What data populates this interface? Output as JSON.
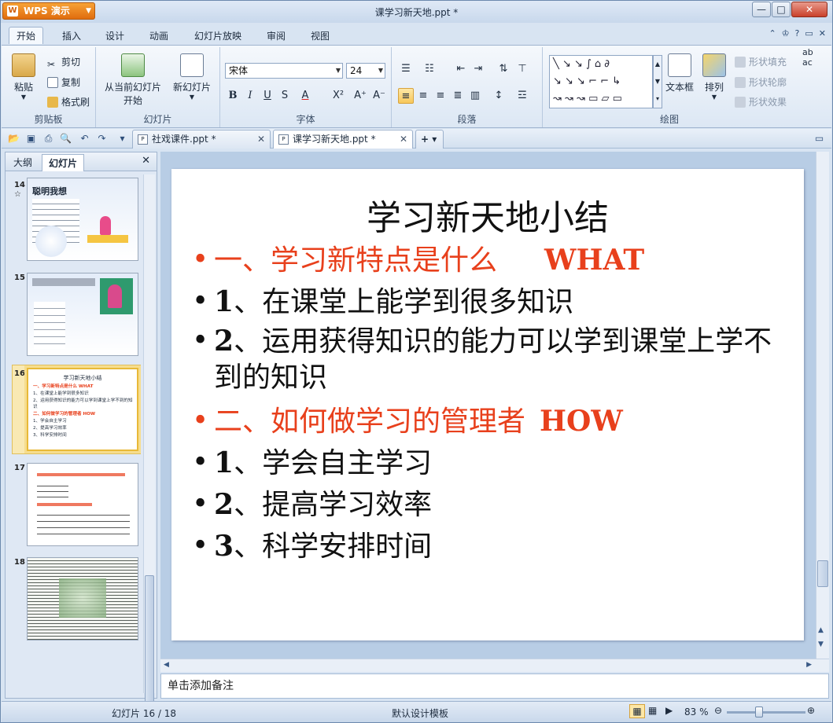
{
  "app": {
    "badge": "WPS 演示",
    "window_title": "课学习新天地.ppt *"
  },
  "ribbon_tabs": [
    "开始",
    "插入",
    "设计",
    "动画",
    "幻灯片放映",
    "审阅",
    "视图"
  ],
  "ribbon": {
    "clipboard": {
      "paste": "粘贴",
      "cut": "剪切",
      "copy": "复制",
      "format_painter": "格式刷",
      "group": "剪贴板"
    },
    "slides": {
      "from_current": "从当前幻灯片",
      "start": "开始",
      "new_slide": "新幻灯片",
      "group": "幻灯片"
    },
    "font": {
      "family": "宋体",
      "size": "24",
      "group": "字体"
    },
    "paragraph": {
      "group": "段落"
    },
    "drawing": {
      "textbox": "文本框",
      "arrange": "排列",
      "shape_fill": "形状填充",
      "shape_outline": "形状轮廓",
      "shape_effect": "形状效果",
      "group": "绘图"
    }
  },
  "doc_tabs": [
    {
      "label": "社戏课件.ppt *",
      "active": false
    },
    {
      "label": "课学习新天地.ppt *",
      "active": true
    }
  ],
  "panel": {
    "tab_outline": "大纲",
    "tab_slides": "幻灯片",
    "numbers": [
      "14",
      "15",
      "16",
      "17",
      "18"
    ],
    "thumb14_title": "聪明我想",
    "thumb16": {
      "title": "学习新天地小结",
      "lines": [
        "一、学习新特点是什么    WHAT",
        "1、在课堂上能学到很多知识",
        "2、运用获得知识的能力可以学到课堂上学不到的知识",
        "二、如何做学习的管理者  HOW",
        "1、学会自主学习",
        "2、提高学习效率",
        "3、科学安排时间"
      ]
    }
  },
  "slide": {
    "title": "学习新天地小结",
    "bullets": [
      {
        "text": "一、学习新特点是什么",
        "en": "WHAT",
        "red": true
      },
      {
        "num": "1",
        "text": "、在课堂上能学到很多知识",
        "red": false
      },
      {
        "num": "2",
        "text": "、运用获得知识的能力可以学到课堂上学不到的知识",
        "red": false
      },
      {
        "text": "二、如何做学习的管理者",
        "en": "HOW",
        "red": true
      },
      {
        "num": "1",
        "text": "、学会自主学习",
        "red": false
      },
      {
        "num": "2",
        "text": "、提高学习效率",
        "red": false
      },
      {
        "num": "3",
        "text": "、科学安排时间",
        "red": false
      }
    ]
  },
  "notes_placeholder": "单击添加备注",
  "status": {
    "slide_count": "幻灯片 16 / 18",
    "template": "默认设计模板",
    "zoom": "83 %"
  },
  "colors": {
    "accent_red": "#e8401c",
    "selection": "#f6dd8e"
  }
}
